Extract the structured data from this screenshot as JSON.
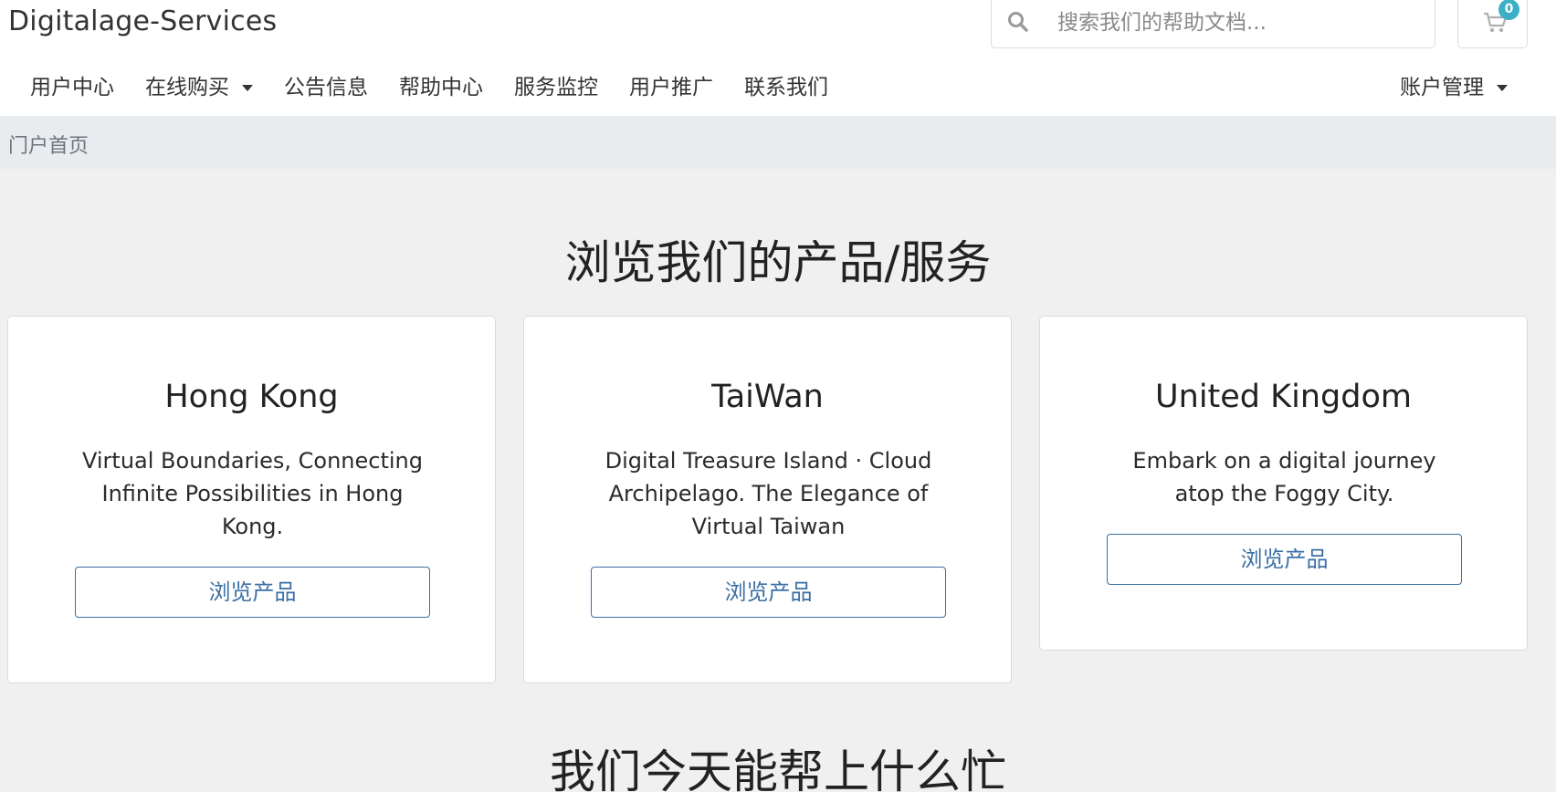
{
  "header": {
    "brand": "Digitalage-Services",
    "search_placeholder": "搜索我们的帮助文档...",
    "cart_count": "0"
  },
  "nav": {
    "items": [
      {
        "label": "用户中心"
      },
      {
        "label": "在线购买"
      },
      {
        "label": "公告信息"
      },
      {
        "label": "帮助中心"
      },
      {
        "label": "服务监控"
      },
      {
        "label": "用户推广"
      },
      {
        "label": "联系我们"
      }
    ],
    "account_label": "账户管理"
  },
  "breadcrumb": {
    "current": "门户首页"
  },
  "products": {
    "title": "浏览我们的产品/服务",
    "cards": [
      {
        "name": "Hong Kong",
        "description": "Virtual Boundaries, Connecting Infinite Possibilities in Hong Kong.",
        "button": "浏览产品"
      },
      {
        "name": "TaiWan",
        "description": "Digital Treasure Island · Cloud Archipelago. The Elegance of Virtual Taiwan",
        "button": "浏览产品"
      },
      {
        "name": "United Kingdom",
        "description": "Embark on a digital journey atop the Foggy City.",
        "button": "浏览产品"
      }
    ]
  },
  "help": {
    "title": "我们今天能帮上什么忙"
  },
  "icons": {
    "search": "search-icon",
    "cart": "cart-icon"
  },
  "colors": {
    "accent": "#3a6fa5",
    "badge": "#3bb0c4",
    "page_bg": "#f0f0f0",
    "breadcrumb_bg": "#e9ecef"
  }
}
